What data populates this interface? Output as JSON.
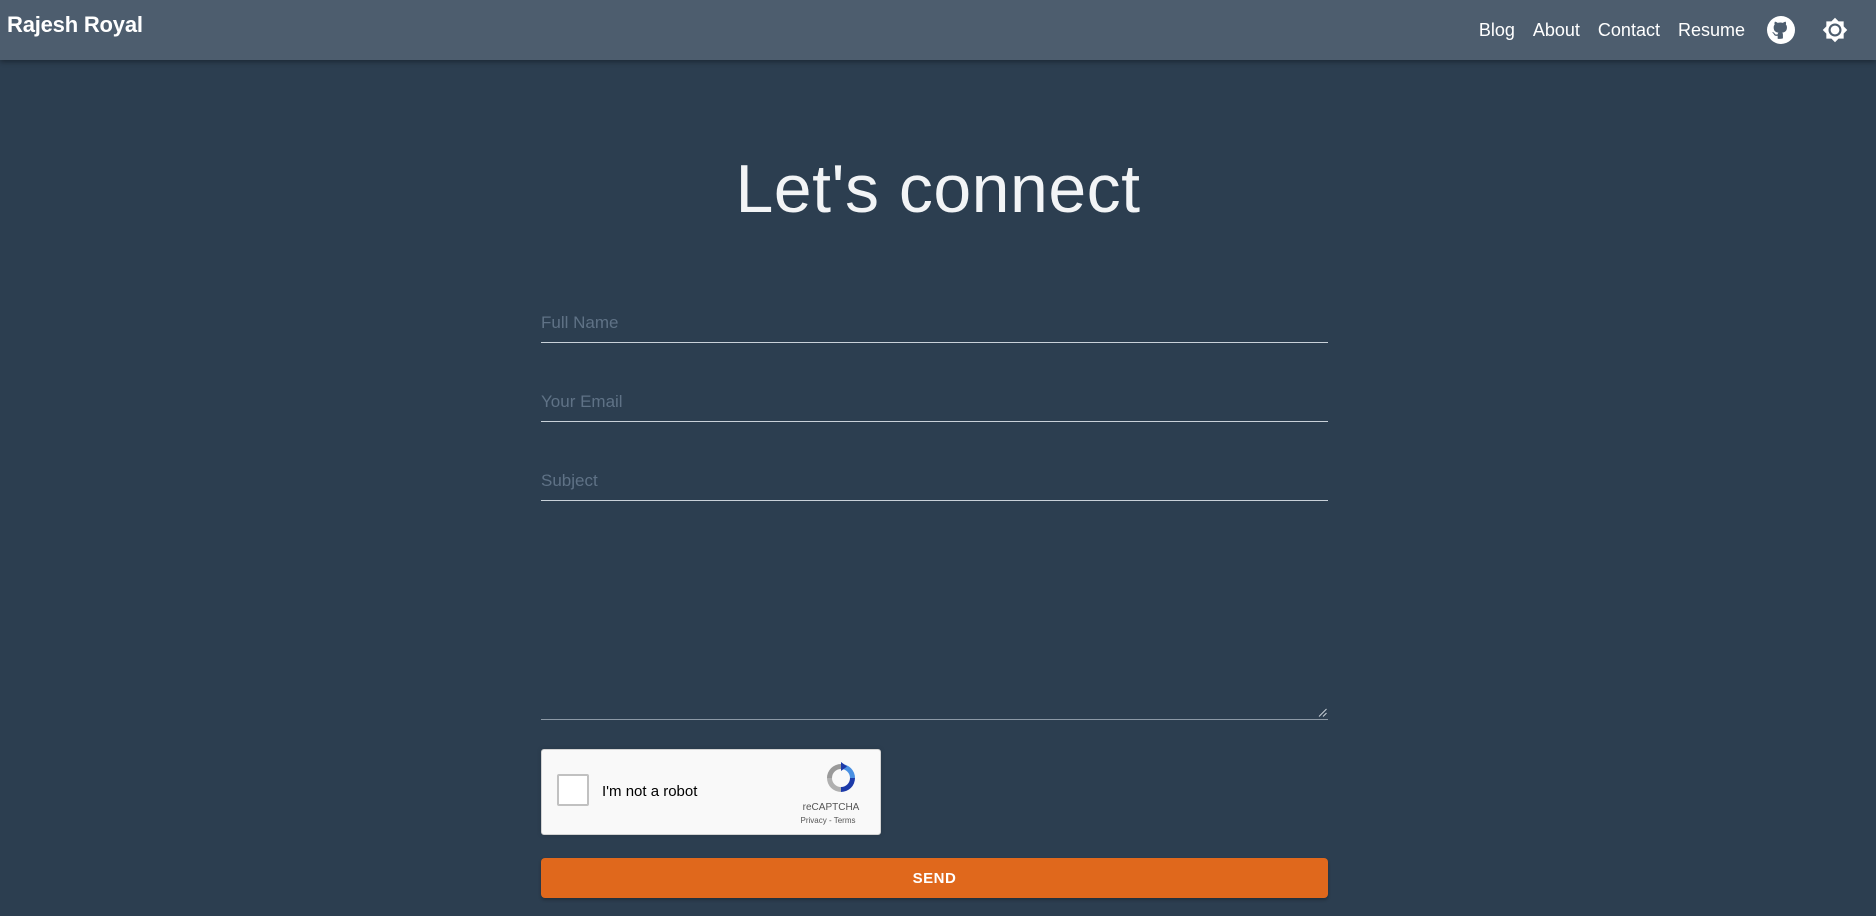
{
  "navbar": {
    "brand": "Rajesh Royal",
    "links": [
      {
        "label": "Blog"
      },
      {
        "label": "About"
      },
      {
        "label": "Contact"
      },
      {
        "label": "Resume"
      }
    ],
    "github_icon": "github-icon",
    "theme_icon": "brightness-icon"
  },
  "main": {
    "title": "Let's connect"
  },
  "form": {
    "full_name": {
      "placeholder": "Full Name",
      "value": ""
    },
    "email": {
      "placeholder": "Your Email",
      "value": ""
    },
    "subject": {
      "placeholder": "Subject",
      "value": ""
    },
    "message": {
      "value": ""
    },
    "recaptcha": {
      "label": "I'm not a robot",
      "brand": "reCAPTCHA",
      "privacy": "Privacy",
      "separator": " - ",
      "terms": "Terms",
      "logo_icon": "recaptcha-logo-icon"
    },
    "send_label": "SEND"
  },
  "colors": {
    "background": "#2c3e50",
    "navbar": "#4d5d6e",
    "accent": "#e0681c"
  }
}
